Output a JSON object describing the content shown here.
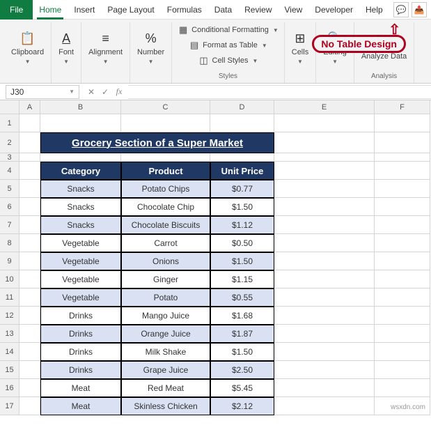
{
  "menu": {
    "file": "File",
    "tabs": [
      "Home",
      "Insert",
      "Page Layout",
      "Formulas",
      "Data",
      "Review",
      "View",
      "Developer",
      "Help"
    ]
  },
  "ribbon": {
    "clipboard": {
      "label": "Clipboard",
      "btn": "Clipboard"
    },
    "font": {
      "label": "Font",
      "btn": "Font"
    },
    "alignment": {
      "label": "Alignment",
      "btn": "Alignment"
    },
    "number": {
      "label": "Number",
      "btn": "Number"
    },
    "styles": {
      "label": "Styles",
      "cond": "Conditional Formatting",
      "fmt": "Format as Table",
      "cell": "Cell Styles"
    },
    "cells": {
      "label": "Cells",
      "btn": "Cells"
    },
    "editing": {
      "label": "Editing",
      "btn": "Editing"
    },
    "analysis": {
      "label": "Analysis",
      "btn": "Analyze Data"
    }
  },
  "annotation": "No Table Design",
  "namebox": "J30",
  "cols": [
    "A",
    "B",
    "C",
    "D",
    "E",
    "F"
  ],
  "title": "Grocery Section of  a Super Market",
  "headers": {
    "cat": "Category",
    "prod": "Product",
    "price": "Unit Price"
  },
  "chart_data": {
    "type": "table",
    "title": "Grocery Section of a Super Market",
    "categories": [
      "Category",
      "Product",
      "Unit Price"
    ],
    "rows": [
      {
        "row": 5,
        "cat": "Snacks",
        "prod": "Potato Chips",
        "price": "$0.77",
        "shade": "light"
      },
      {
        "row": 6,
        "cat": "Snacks",
        "prod": "Chocolate Chip",
        "price": "$1.50",
        "shade": "dark"
      },
      {
        "row": 7,
        "cat": "Snacks",
        "prod": "Chocolate Biscuits",
        "price": "$1.12",
        "shade": "light"
      },
      {
        "row": 8,
        "cat": "Vegetable",
        "prod": "Carrot",
        "price": "$0.50",
        "shade": "dark"
      },
      {
        "row": 9,
        "cat": "Vegetable",
        "prod": "Onions",
        "price": "$1.50",
        "shade": "light"
      },
      {
        "row": 10,
        "cat": "Vegetable",
        "prod": "Ginger",
        "price": "$1.15",
        "shade": "dark"
      },
      {
        "row": 11,
        "cat": "Vegetable",
        "prod": "Potato",
        "price": "$0.55",
        "shade": "light"
      },
      {
        "row": 12,
        "cat": "Drinks",
        "prod": "Mango Juice",
        "price": "$1.68",
        "shade": "dark"
      },
      {
        "row": 13,
        "cat": "Drinks",
        "prod": "Orange Juice",
        "price": "$1.87",
        "shade": "light"
      },
      {
        "row": 14,
        "cat": "Drinks",
        "prod": "Milk Shake",
        "price": "$1.50",
        "shade": "dark"
      },
      {
        "row": 15,
        "cat": "Drinks",
        "prod": "Grape Juice",
        "price": "$2.50",
        "shade": "light"
      },
      {
        "row": 16,
        "cat": "Meat",
        "prod": "Red Meat",
        "price": "$5.45",
        "shade": "dark"
      },
      {
        "row": 17,
        "cat": "Meat",
        "prod": "Skinless Chicken",
        "price": "$2.12",
        "shade": "light"
      }
    ]
  },
  "watermark": "wsxdn.com"
}
